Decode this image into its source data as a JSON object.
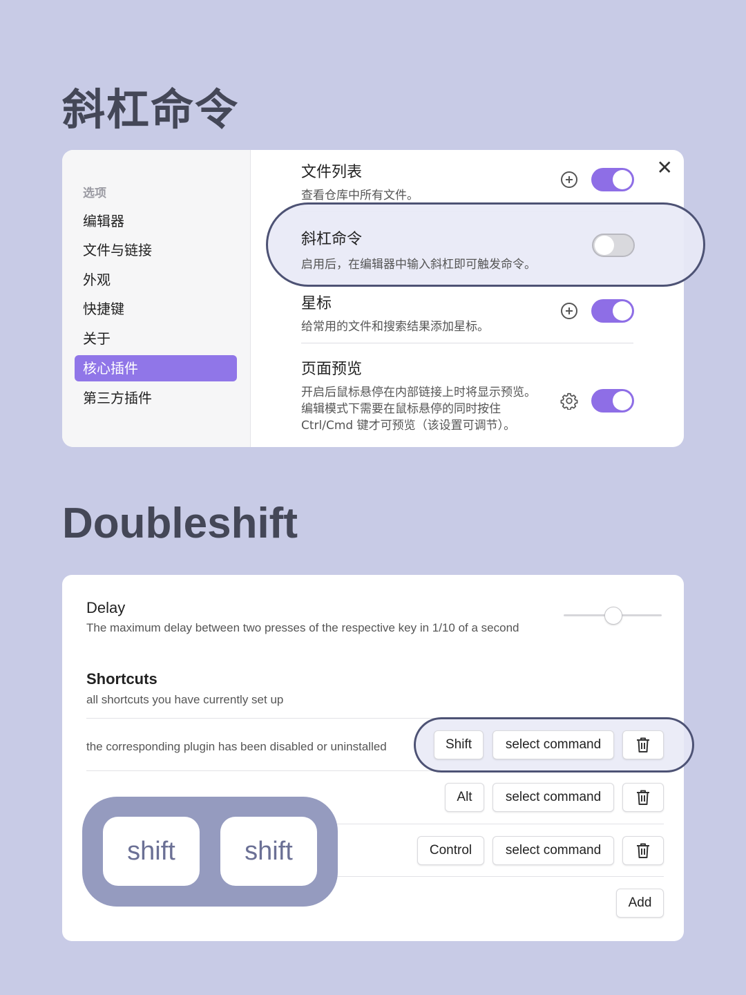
{
  "headings": {
    "section1": "斜杠命令",
    "section2": "Doubleshift"
  },
  "settings_window": {
    "sidebar": {
      "heading": "选项",
      "items": [
        {
          "label": "编辑器"
        },
        {
          "label": "文件与链接"
        },
        {
          "label": "外观"
        },
        {
          "label": "快捷键"
        },
        {
          "label": "关于"
        },
        {
          "label": "核心插件",
          "active": true
        },
        {
          "label": "第三方插件"
        }
      ]
    },
    "close_icon": "close-icon",
    "accent_color": "#9076e8",
    "plugins": [
      {
        "title": "文件列表",
        "description": "查看仓库中所有文件。",
        "icon": "plus-circle-icon",
        "enabled": true
      },
      {
        "title": "斜杠命令",
        "description": "启用后，在编辑器中输入斜杠即可触发命令。",
        "enabled": false,
        "highlighted": true
      },
      {
        "title": "星标",
        "description": "给常用的文件和搜索结果添加星标。",
        "icon": "plus-circle-icon",
        "enabled": true
      },
      {
        "title": "页面预览",
        "description": "开启后鼠标悬停在内部链接上时将显示预览。编辑模式下需要在鼠标悬停的同时按住 Ctrl/Cmd 键才可预览（该设置可调节）。",
        "icon": "gear-icon",
        "enabled": true
      }
    ]
  },
  "doubleshift_panel": {
    "delay": {
      "title": "Delay",
      "description": "The maximum delay between two presses of the respective key in 1/10 of a second",
      "slider_fraction": 0.5
    },
    "shortcuts": {
      "title": "Shortcuts",
      "description": "all shortcuts you have currently set up",
      "rows": [
        {
          "warning": "the corresponding plugin has been disabled or uninstalled",
          "key": "Shift",
          "command": "select command",
          "highlighted": true
        },
        {
          "warning": "",
          "key": "Alt",
          "command": "select command"
        },
        {
          "warning": "",
          "key": "Control",
          "command": "select command"
        }
      ],
      "add_label": "Add"
    }
  },
  "overlay_keys": [
    "shift",
    "shift"
  ]
}
